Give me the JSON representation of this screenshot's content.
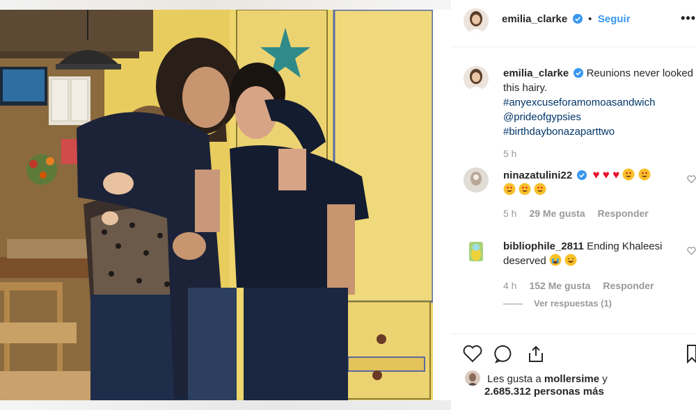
{
  "post": {
    "username": "emilia_clarke",
    "follow_label": "Seguir",
    "dot": "•",
    "more_label": "•••"
  },
  "caption": {
    "username": "emilia_clarke",
    "text": "Reunions never looked this hairy.",
    "text_line1": "Reunions never looked",
    "text_line2": "this hairy.",
    "hashtags": [
      "#anyexcuseforamomoasandwich",
      "@prideofgypsies",
      "#birthdaybonazaparttwo"
    ],
    "time": "5 h"
  },
  "comments": [
    {
      "username": "ninazatulini22",
      "verified": true,
      "text": "",
      "time": "5 h",
      "likes": "29 Me gusta",
      "reply": "Responder"
    },
    {
      "username": "bibliophile_2811",
      "verified": false,
      "text": "Ending Khaleesi",
      "text_line2": "deserved",
      "time": "4 h",
      "likes": "152 Me gusta",
      "reply": "Responder",
      "view_replies": "Ver respuestas (1)"
    }
  ],
  "likes": {
    "prefix": "Les gusta a",
    "user": "mollersime",
    "conj": "y",
    "count": "2.685.312 personas más"
  },
  "icons": [
    "verified-badge-icon",
    "heart-icon",
    "comment-icon",
    "share-icon",
    "bookmark-icon",
    "small-heart-icon"
  ],
  "colors": {
    "link_blue": "#3897f0",
    "hashtag": "#003569",
    "muted": "#999999",
    "verified": "#3897f0",
    "heart_red": "#e8112d"
  }
}
